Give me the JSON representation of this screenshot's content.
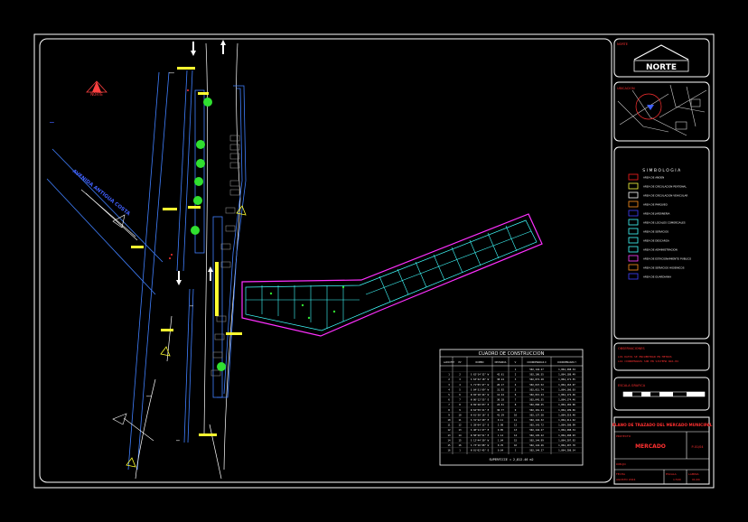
{
  "north_logo": {
    "text": "NORTE",
    "label": "NORTE"
  },
  "north_arrow": {
    "label": "NORTE"
  },
  "street_label": "AVENIDA ANTIGUA COSTA",
  "location_panel": {
    "title": "UBICACION"
  },
  "legend": {
    "title": "SIMBOLOGIA",
    "items": [
      {
        "label": "AREA DE ANDEN",
        "color": "#ff2020"
      },
      {
        "label": "AREA DE CIRCULACION PEATONAL",
        "color": "#ffff40"
      },
      {
        "label": "AREA DE CIRCULACION VEHICULAR",
        "color": "#ffffff"
      },
      {
        "label": "AREA DE PARQUEO",
        "color": "#ff9020"
      },
      {
        "label": "AREA DE JARDINERIA",
        "color": "#4040ff"
      },
      {
        "label": "AREA DE LOCALES COMERCIALES",
        "color": "#40ffff"
      },
      {
        "label": "AREA DE SERVICIOS",
        "color": "#40ffff"
      },
      {
        "label": "AREA DE DESCARGA",
        "color": "#40ffff"
      },
      {
        "label": "AREA DE ADMINISTRACION",
        "color": "#40ffff"
      },
      {
        "label": "AREA DE ESTACIONAMIENTO PUBLICO",
        "color": "#ff40ff"
      },
      {
        "label": "AREA DE SERVICIOS HIGIENICOS",
        "color": "#ff9020"
      },
      {
        "label": "AREA DE GUARDIANIA",
        "color": "#4040ff"
      }
    ]
  },
  "notes": {
    "title": "OBSERVACIONES",
    "lines": [
      "LOS DATOS SE ENCUENTRAN EN METROS",
      "LAS COORDENADAS SON EN SISTEMA WGS-84"
    ]
  },
  "scale": {
    "title": "ESCALA GRAFICA"
  },
  "title_block": {
    "project": "PLANO DE TRAZADO DEL MERCADO MUNICIPAL",
    "field_project_label": "PROYECTO",
    "project_value": "MERCADO",
    "sheet_code": "P-01/04",
    "field_drawn_label": "DIBUJO",
    "field_date_label": "FECHA",
    "date_value": "AGOSTO 2024",
    "field_scale_label": "ESCALA",
    "scale_value": "1:500",
    "field_sheet_label": "LAMINA",
    "sheet_value": "01/04"
  },
  "table": {
    "title": "CUADRO DE CONSTRUCCION",
    "headers": [
      "LADO EST",
      "PV",
      "RUMBO",
      "DISTANCIA",
      "V",
      "COORDENADAS X",
      "COORDENADAS Y"
    ],
    "rows": [
      [
        "",
        "",
        "",
        "",
        "1",
        "502,144.27",
        "1,864,208.34"
      ],
      [
        "1",
        "2",
        "S 62°14'32\" W",
        "42.61",
        "2",
        "502,106.55",
        "1,864,188.49"
      ],
      [
        "2",
        "3",
        "S 63°42'18\" W",
        "38.24",
        "3",
        "502,072.28",
        "1,864,171.55"
      ],
      [
        "3",
        "4",
        "S 71°05'47\" W",
        "26.17",
        "4",
        "502,047.52",
        "1,864,163.07"
      ],
      [
        "4",
        "5",
        "S 84°31'09\" W",
        "31.92",
        "5",
        "502,015.74",
        "1,864,160.03"
      ],
      [
        "5",
        "6",
        "N 02°18'44\" W",
        "12.44",
        "6",
        "502,015.24",
        "1,864,172.46"
      ],
      [
        "6",
        "7",
        "N 86°12'55\" E",
        "30.18",
        "7",
        "502,045.35",
        "1,864,174.46"
      ],
      [
        "7",
        "8",
        "N 69°48'03\" E",
        "24.61",
        "8",
        "502,068.45",
        "1,864,182.96"
      ],
      [
        "8",
        "9",
        "N 62°59'21\" E",
        "36.77",
        "9",
        "502,101.21",
        "1,864,199.66"
      ],
      [
        "9",
        "10",
        "N 61°30'16\" E",
        "41.39",
        "10",
        "502,137.58",
        "1,864,219.40"
      ],
      [
        "10",
        "11",
        "S 31°22'40\" E",
        "9.11",
        "11",
        "502,142.32",
        "1,864,211.62"
      ],
      [
        "11",
        "12",
        "S 28°04'12\" E",
        "2.98",
        "12",
        "502,143.72",
        "1,864,208.99"
      ],
      [
        "12",
        "13",
        "S 40°11'27\" E",
        "0.85",
        "13",
        "502,144.27",
        "1,864,208.34"
      ],
      [
        "13",
        "14",
        "N 58°20'51\" E",
        "1.12",
        "14",
        "502,145.22",
        "1,864,208.93"
      ],
      [
        "14",
        "15",
        "S 12°44'30\" W",
        "1.04",
        "15",
        "502,144.99",
        "1,864,207.92"
      ],
      [
        "15",
        "16",
        "S 73°16'08\" W",
        "0.76",
        "16",
        "502,144.26",
        "1,864,207.70"
      ],
      [
        "16",
        "1",
        "N 01°02'45\" E",
        "0.64",
        "1",
        "502,144.27",
        "1,864,208.34"
      ]
    ],
    "footer": "SUPERFICIE = 2,812.46 m2"
  }
}
